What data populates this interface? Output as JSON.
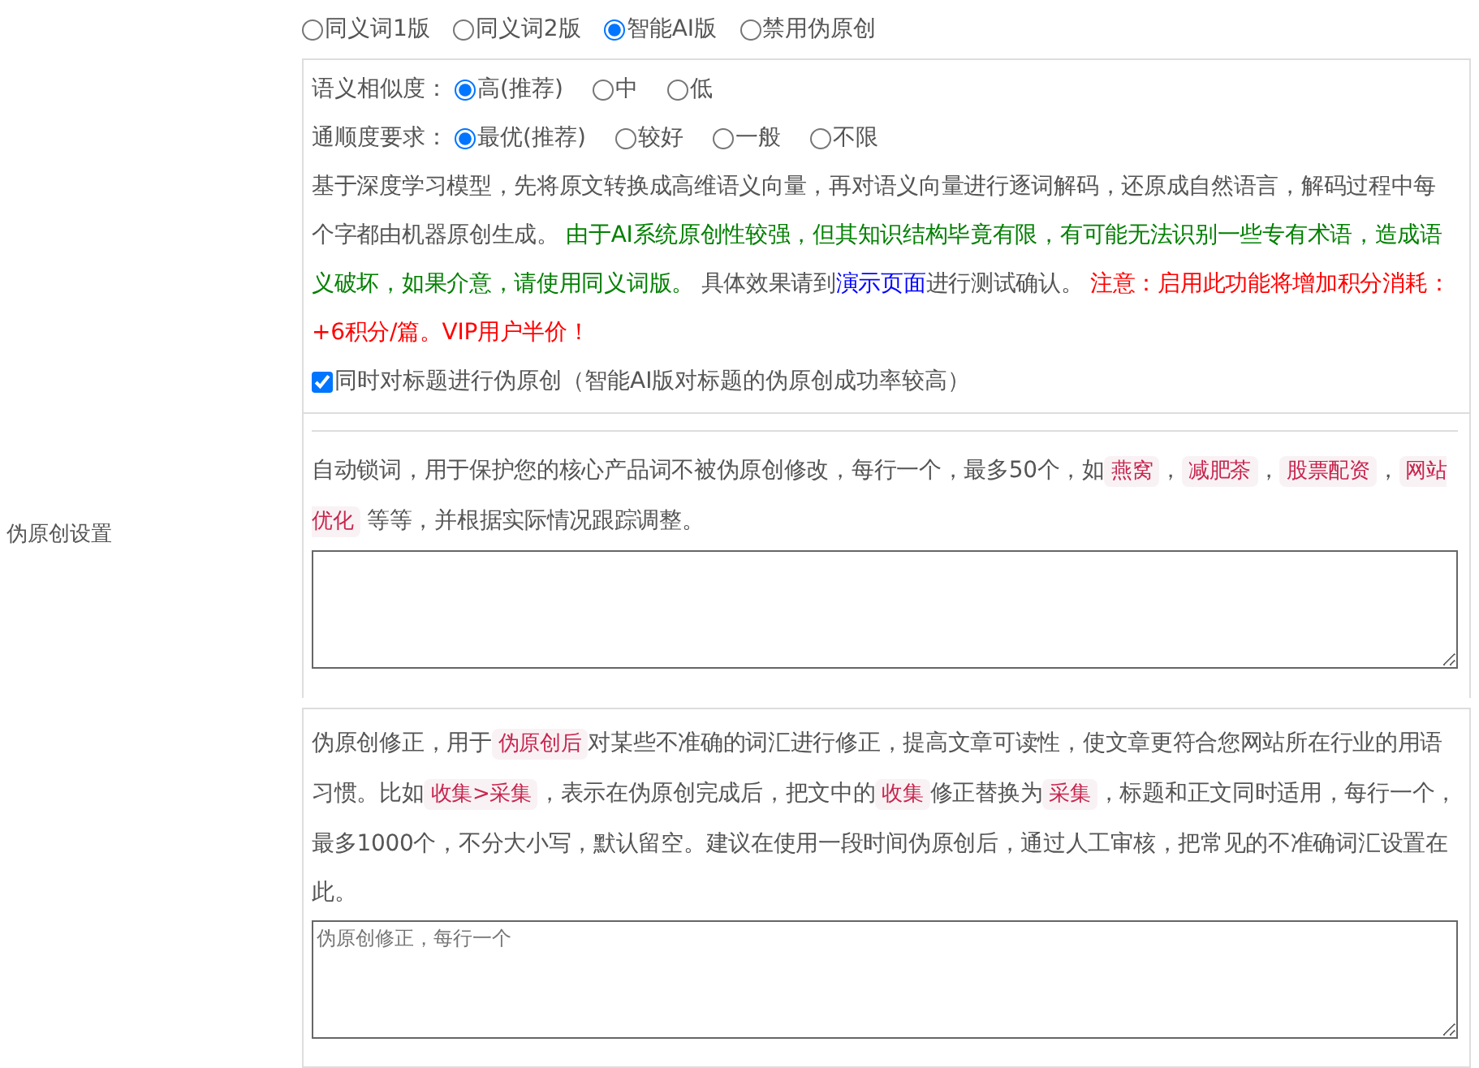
{
  "section_label": "伪原创设置",
  "modes": [
    {
      "label": "同义词1版",
      "selected": false
    },
    {
      "label": "同义词2版",
      "selected": false
    },
    {
      "label": "智能AI版",
      "selected": true
    },
    {
      "label": "禁用伪原创",
      "selected": false
    }
  ],
  "ai_settings": [
    {
      "label": "语义相似度：",
      "options": [
        {
          "label": "高(推荐)",
          "selected": true
        },
        {
          "label": "中",
          "selected": false
        },
        {
          "label": "低",
          "selected": false
        }
      ]
    },
    {
      "label": "通顺度要求：",
      "options": [
        {
          "label": "最优(推荐)",
          "selected": true
        },
        {
          "label": "较好",
          "selected": false
        },
        {
          "label": "一般",
          "selected": false
        },
        {
          "label": "不限",
          "selected": false
        }
      ]
    }
  ],
  "ai_description": [
    {
      "kind": "plain",
      "text": "基于深度学习模型，先将原文转换成高维语义向量，再对语义向量进行逐词解码，还原成自然语言，解码过程中每个字都由机器原创生成。 "
    },
    {
      "kind": "note",
      "text": "由于AI系统原创性较强，但其知识结构毕竟有限，有可能无法识别一些专有术语，造成语义破坏，如果介意，请使用同义词版。"
    },
    {
      "kind": "plain",
      "text": " 具体效果请到"
    },
    {
      "kind": "link",
      "text": "演示页面"
    },
    {
      "kind": "plain",
      "text": "进行测试确认。 "
    },
    {
      "kind": "warning",
      "text": "注意：启用此功能将增加积分消耗：+6积分/篇。VIP用户半价！"
    }
  ],
  "title_checkbox": {
    "label": "同时对标题进行伪原创（智能AI版对标题的伪原创成功率较高）",
    "checked": true
  },
  "auto_lock": {
    "description": [
      {
        "kind": "plain",
        "text": "自动锁词，用于保护您的核心产品词不被伪原创修改，每行一个，最多50个，如"
      },
      {
        "kind": "tag",
        "text": "燕窝"
      },
      {
        "kind": "plain",
        "text": "，"
      },
      {
        "kind": "tag",
        "text": "减肥茶"
      },
      {
        "kind": "plain",
        "text": "，"
      },
      {
        "kind": "tag",
        "text": "股票配资"
      },
      {
        "kind": "plain",
        "text": "，"
      },
      {
        "kind": "tag",
        "text": "网站优化"
      },
      {
        "kind": "plain",
        "text": " 等等，并根据实际情况跟踪调整。"
      }
    ]
  },
  "correction": {
    "description": [
      {
        "kind": "plain",
        "text": "伪原创修正，用于"
      },
      {
        "kind": "tag",
        "text": "伪原创后"
      },
      {
        "kind": "plain",
        "text": "对某些不准确的词汇进行修正，提高文章可读性，使文章更符合您网站所在行业的用语习惯。比如"
      },
      {
        "kind": "tag",
        "text": "收集>采集"
      },
      {
        "kind": "plain",
        "text": "，表示在伪原创完成后，把文中的"
      },
      {
        "kind": "tag",
        "text": "收集"
      },
      {
        "kind": "plain",
        "text": "修正替换为"
      },
      {
        "kind": "tag",
        "text": "采集"
      },
      {
        "kind": "plain",
        "text": "，标题和正文同时适用，每行一个，最多1000个，不分大小写，默认留空。建议在使用一段时间伪原创后，通过人工审核，把常见的不准确词汇设置在此。"
      }
    ],
    "placeholder": "伪原创修正，每行一个"
  }
}
